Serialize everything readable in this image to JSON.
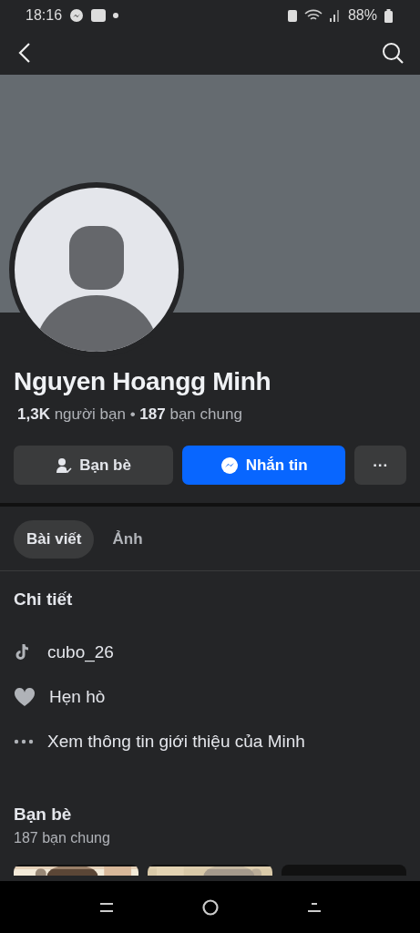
{
  "status_bar": {
    "time": "18:16",
    "battery": "88%"
  },
  "profile": {
    "name": "Nguyen Hoangg Minh",
    "stats": "**1,3K** người bạn  •  **187** bạn chung"
  },
  "actions": [
    {
      "kind": "friends",
      "label": "Bạn bè"
    },
    {
      "kind": "message",
      "label": "Nhắn tin"
    },
    {
      "kind": "more",
      "label": "···"
    }
  ],
  "tabs": [
    {
      "label": "Bài viết",
      "selected": true
    },
    {
      "label": "Ảnh",
      "selected": false
    }
  ],
  "details": {
    "title": "Chi tiết",
    "items": [
      {
        "kind": "tiktok",
        "text": "cubo_26"
      },
      {
        "kind": "heart",
        "text": "Hẹn hò"
      },
      {
        "kind": "more",
        "text": "Xem thông tin giới thiệu của Minh"
      }
    ]
  },
  "friends": {
    "title": "Bạn bè",
    "subtitle": "187 bạn chung",
    "cards": [
      {
        "kind": "picture"
      },
      {
        "kind": "picture"
      },
      {
        "kind": "blank"
      }
    ]
  }
}
